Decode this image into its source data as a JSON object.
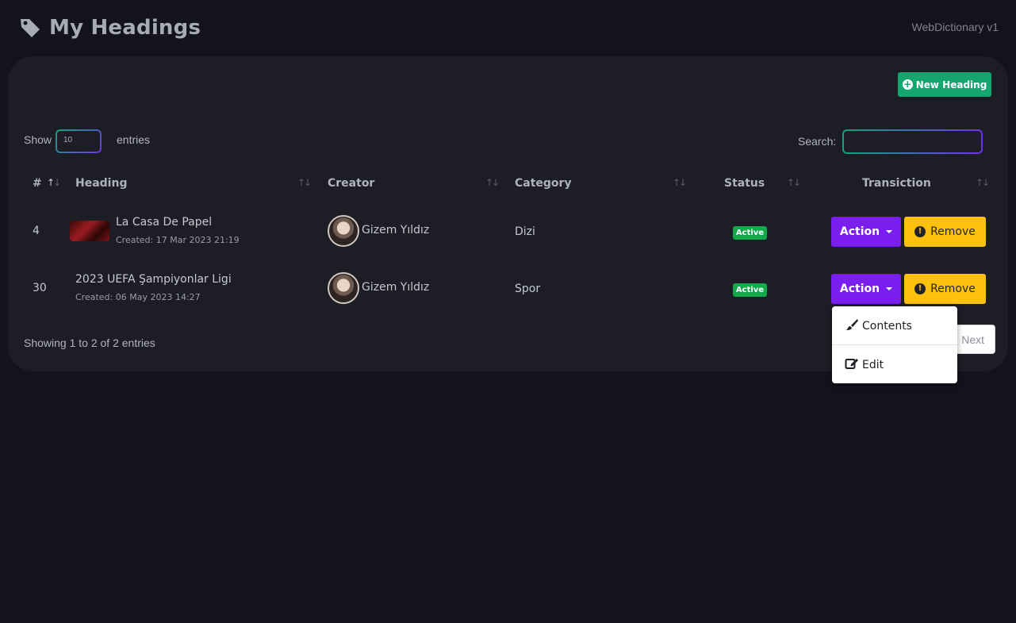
{
  "page": {
    "title": "My Headings",
    "version": "WebDictionary v1"
  },
  "toolbar": {
    "new_heading_label": "New Heading",
    "show_label": "Show",
    "show_value": "10",
    "entries_label": "entries",
    "search_label": "Search:"
  },
  "table": {
    "columns": [
      "#",
      "Heading",
      "Creator",
      "Category",
      "Status",
      "Transiction"
    ],
    "rows": [
      {
        "id": "4",
        "heading": "La Casa De Papel",
        "created": "Created: 17 Mar 2023 21:19",
        "creator": "Gizem Yıldız",
        "category": "Dizi",
        "status": "Active",
        "action_label": "Action",
        "remove_label": "Remove"
      },
      {
        "id": "30",
        "heading": "2023 UEFA Şampiyonlar Ligi",
        "created": "Created: 06 May 2023 14:27",
        "creator": "Gizem Yıldız",
        "category": "Spor",
        "status": "Active",
        "action_label": "Action",
        "remove_label": "Remove"
      }
    ]
  },
  "dropdown": {
    "items": [
      "Contents",
      "Edit"
    ]
  },
  "footer": {
    "info": "Showing 1 to 2 of 2 entries",
    "next_label": "Next"
  },
  "colors": {
    "background": "#13131c",
    "card": "#1c1d25",
    "new_button": "#15a571",
    "action_button": "#7a1ef0",
    "remove_button": "#fec10e",
    "badge_active": "#14a84d"
  }
}
